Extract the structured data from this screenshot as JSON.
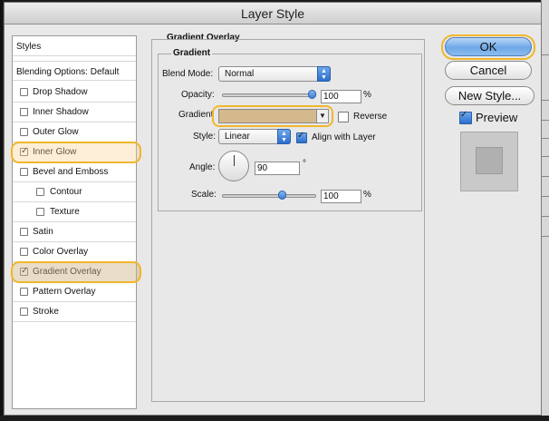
{
  "window": {
    "title": "Layer Style"
  },
  "styles_panel": {
    "header": "Styles",
    "blending": "Blending Options: Default",
    "items": [
      {
        "label": "Drop Shadow",
        "checked": false,
        "sub": false
      },
      {
        "label": "Inner Shadow",
        "checked": false,
        "sub": false
      },
      {
        "label": "Outer Glow",
        "checked": false,
        "sub": false
      },
      {
        "label": "Inner Glow",
        "checked": true,
        "sub": false
      },
      {
        "label": "Bevel and Emboss",
        "checked": false,
        "sub": false
      },
      {
        "label": "Contour",
        "checked": false,
        "sub": true
      },
      {
        "label": "Texture",
        "checked": false,
        "sub": true
      },
      {
        "label": "Satin",
        "checked": false,
        "sub": false
      },
      {
        "label": "Color Overlay",
        "checked": false,
        "sub": false
      },
      {
        "label": "Gradient Overlay",
        "checked": true,
        "sub": false
      },
      {
        "label": "Pattern Overlay",
        "checked": false,
        "sub": false
      },
      {
        "label": "Stroke",
        "checked": false,
        "sub": false
      }
    ]
  },
  "gradient_overlay": {
    "section_title": "Gradient Overlay",
    "group_title": "Gradient",
    "blend_mode_label": "Blend Mode:",
    "blend_mode_value": "Normal",
    "opacity_label": "Opacity:",
    "opacity_value": "100",
    "opacity_level": 1.0,
    "opacity_unit": "%",
    "gradient_label": "Gradient",
    "gradient_color": "#d3b98c",
    "reverse_label": "Reverse",
    "reverse_checked": false,
    "style_label": "Style:",
    "style_value": "Linear",
    "align_label": "Align with Layer",
    "align_checked": true,
    "angle_label": "Angle:",
    "angle_value": "90",
    "angle_unit": "°",
    "scale_label": "Scale:",
    "scale_value": "100",
    "scale_level": 0.65,
    "scale_unit": "%"
  },
  "buttons": {
    "ok": "OK",
    "cancel": "Cancel",
    "new_style": "New Style...",
    "preview_label": "Preview",
    "preview_checked": true
  },
  "colors": {
    "highlight": "#f1b62b",
    "accent": "#3b7fd6"
  }
}
